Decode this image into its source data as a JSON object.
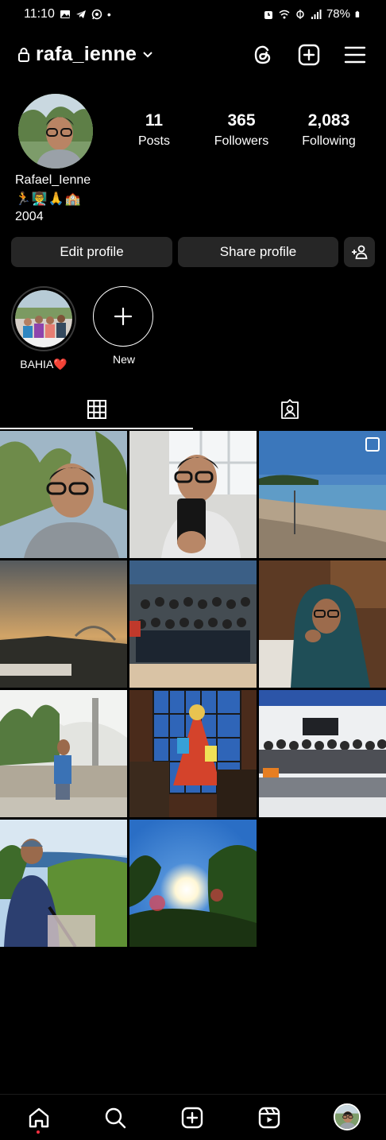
{
  "status_bar": {
    "time": "11:10",
    "battery": "78%",
    "icons_left": [
      "gallery-icon",
      "telegram-icon",
      "whatsapp-icon",
      "dot-icon"
    ],
    "icons_right": [
      "alarm-icon",
      "wifi-icon",
      "data-icon",
      "signal-icon",
      "battery-icon"
    ]
  },
  "header": {
    "username": "rafa_ienne",
    "icons": [
      "lock-icon",
      "chevron-down-icon",
      "threads-icon",
      "create-post-icon",
      "menu-icon"
    ]
  },
  "profile": {
    "stats": [
      {
        "value": "11",
        "label": "Posts"
      },
      {
        "value": "365",
        "label": "Followers"
      },
      {
        "value": "2,083",
        "label": "Following"
      }
    ],
    "name": "Rafael_Ienne",
    "bio_emoji": "🏃👨‍🏫🙏🏫",
    "bio_line": "2004",
    "buttons": {
      "edit": "Edit profile",
      "share": "Share profile"
    }
  },
  "highlights": [
    {
      "label": "BAHIA❤️"
    },
    {
      "label": "New"
    }
  ],
  "tabs": [
    {
      "name": "posts-grid-tab",
      "active": true
    },
    {
      "name": "tagged-tab",
      "active": false
    }
  ],
  "posts_count_grid": 11,
  "bottom_nav": [
    "home-icon",
    "search-icon",
    "create-icon",
    "reels-icon",
    "profile-avatar"
  ],
  "colors": {
    "background": "#000000",
    "button": "#262626",
    "notification_dot": "#ff3040"
  }
}
